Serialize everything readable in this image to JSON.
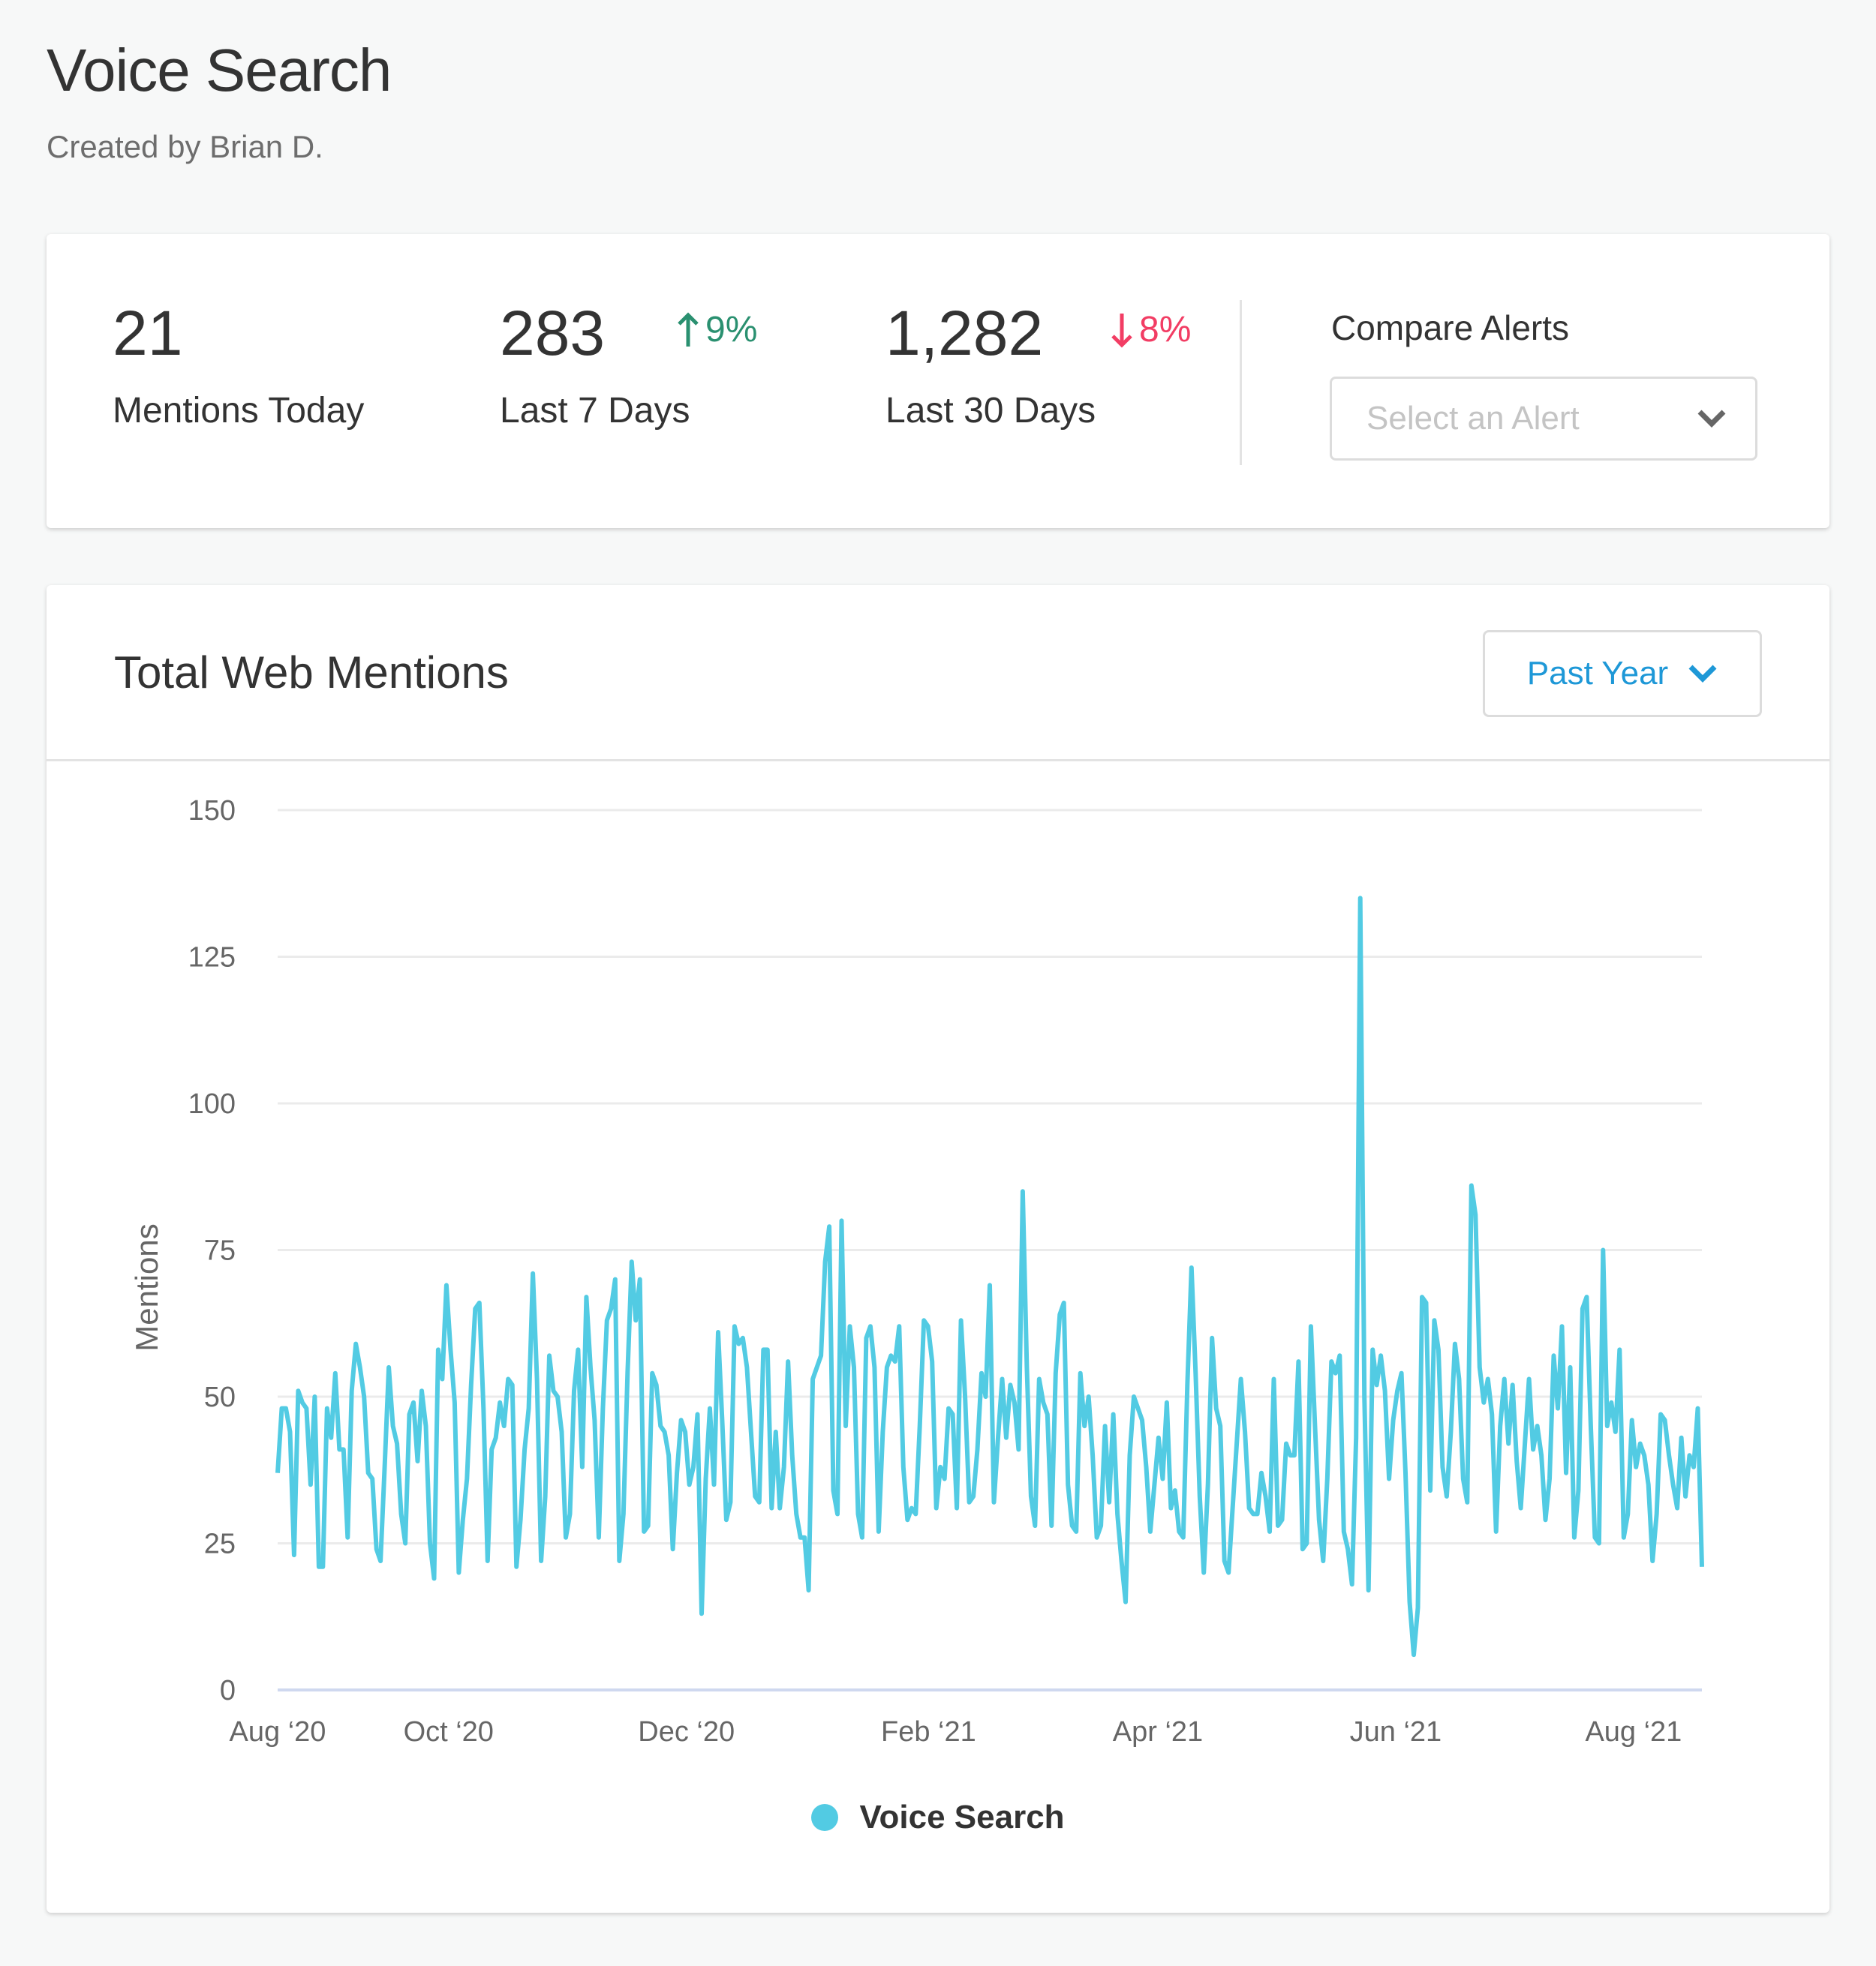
{
  "header": {
    "title": "Voice Search",
    "subtitle": "Created by Brian D."
  },
  "stats": {
    "today": {
      "value": "21",
      "label": "Mentions Today"
    },
    "last7": {
      "value": "283",
      "label": "Last 7 Days",
      "delta": "9%",
      "direction": "up",
      "icon": "arrow-up-icon"
    },
    "last30": {
      "value": "1,282",
      "label": "Last 30 Days",
      "delta": "8%",
      "direction": "down",
      "icon": "arrow-down-icon"
    },
    "compare": {
      "label": "Compare Alerts",
      "placeholder": "Select an Alert",
      "icon": "chevron-down-icon"
    }
  },
  "chart_card": {
    "title": "Total Web Mentions",
    "range_label": "Past Year",
    "range_icon": "chevron-down-icon"
  },
  "colors": {
    "series": "#52cbe3",
    "up": "#2a9070",
    "down": "#f23d64",
    "accent": "#1e98d7",
    "axis": "#cfd8ef",
    "grid": "#ebebeb"
  },
  "chart_data": {
    "type": "line",
    "title": "Total Web Mentions",
    "xlabel": "",
    "ylabel": "Mentions",
    "ylim": [
      0,
      150
    ],
    "yticks": [
      0,
      25,
      50,
      75,
      100,
      125,
      150
    ],
    "xtick_labels": [
      "Aug ‘20",
      "Oct ‘20",
      "Dec ‘20",
      "Feb ‘21",
      "Apr ‘21",
      "Jun ‘21",
      "Aug ‘21"
    ],
    "xtick_positions": [
      0,
      0.12,
      0.287,
      0.457,
      0.618,
      0.785,
      0.952
    ],
    "grid": true,
    "legend": {
      "position": "bottom",
      "entries": [
        "Voice Search"
      ]
    },
    "series": [
      {
        "name": "Voice Search",
        "values": [
          37,
          48,
          48,
          44,
          23,
          51,
          49,
          48,
          35,
          50,
          21,
          21,
          48,
          43,
          54,
          41,
          41,
          26,
          51,
          59,
          55,
          50,
          37,
          36,
          24,
          22,
          38,
          55,
          45,
          42,
          30,
          25,
          47,
          49,
          39,
          51,
          45,
          25,
          19,
          58,
          53,
          69,
          58,
          49,
          20,
          29,
          36,
          52,
          65,
          66,
          48,
          22,
          41,
          43,
          49,
          45,
          53,
          52,
          21,
          29,
          41,
          48,
          71,
          53,
          22,
          33,
          57,
          51,
          50,
          44,
          26,
          30,
          51,
          58,
          38,
          67,
          55,
          46,
          26,
          48,
          63,
          65,
          70,
          22,
          30,
          54,
          73,
          63,
          70,
          27,
          28,
          54,
          52,
          45,
          44,
          40,
          24,
          37,
          46,
          44,
          35,
          38,
          47,
          13,
          36,
          48,
          35,
          61,
          46,
          29,
          32,
          62,
          59,
          60,
          55,
          44,
          33,
          32,
          58,
          58,
          31,
          44,
          31,
          38,
          56,
          40,
          30,
          26,
          26,
          17,
          53,
          55,
          57,
          73,
          79,
          34,
          30,
          80,
          45,
          62,
          55,
          30,
          26,
          60,
          62,
          55,
          27,
          44,
          55,
          57,
          56,
          62,
          38,
          29,
          31,
          30,
          45,
          63,
          62,
          56,
          31,
          38,
          36,
          48,
          47,
          31,
          63,
          50,
          32,
          33,
          41,
          54,
          50,
          69,
          32,
          43,
          53,
          43,
          52,
          49,
          41,
          85,
          55,
          33,
          28,
          53,
          49,
          47,
          28,
          54,
          64,
          66,
          35,
          28,
          27,
          54,
          45,
          50,
          40,
          26,
          28,
          45,
          32,
          47,
          30,
          22,
          15,
          40,
          50,
          48,
          46,
          38,
          27,
          35,
          43,
          36,
          49,
          31,
          34,
          27,
          26,
          52,
          72,
          54,
          33,
          20,
          35,
          60,
          48,
          45,
          22,
          20,
          31,
          42,
          53,
          44,
          31,
          30,
          30,
          37,
          33,
          27,
          53,
          28,
          29,
          42,
          40,
          40,
          56,
          24,
          25,
          62,
          45,
          29,
          22,
          36,
          56,
          54,
          57,
          27,
          24,
          18,
          43,
          135,
          50,
          17,
          58,
          52,
          57,
          51,
          36,
          46,
          51,
          54,
          37,
          15,
          6,
          14,
          67,
          66,
          34,
          63,
          58,
          38,
          33,
          44,
          59,
          53,
          36,
          32,
          86,
          81,
          55,
          49,
          53,
          47,
          27,
          45,
          53,
          42,
          52,
          39,
          31,
          42,
          53,
          41,
          45,
          40,
          29,
          36,
          57,
          48,
          62,
          37,
          55,
          26,
          34,
          65,
          67,
          45,
          26,
          25,
          75,
          45,
          49,
          44,
          58,
          26,
          30,
          46,
          38,
          42,
          40,
          35,
          22,
          30,
          47,
          46,
          40,
          35,
          31,
          43,
          33,
          40,
          38,
          48,
          21
        ]
      }
    ]
  }
}
